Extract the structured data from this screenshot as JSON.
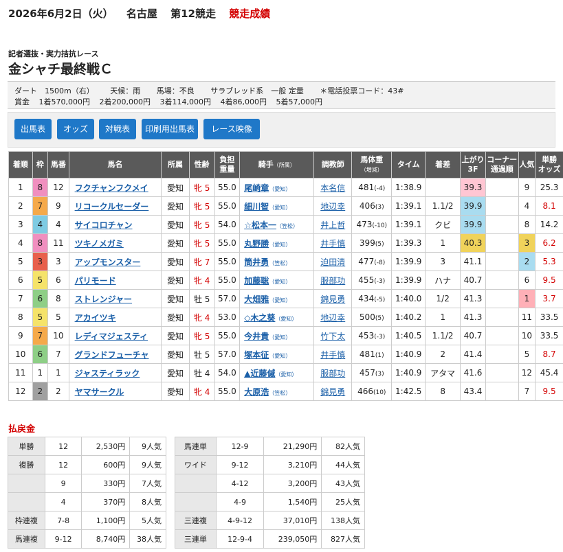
{
  "header": {
    "date": "2026年6月2日（火）",
    "venue": "名古屋",
    "race_no": "第12競走",
    "status": "競走成績"
  },
  "race": {
    "subtitle": "記者選抜・実力拮抗レース",
    "title": "金シャチ最終戦Ｃ"
  },
  "info": {
    "course": "ダート　1500m（右）",
    "weather": "天候：雨",
    "track": "馬場：不良",
    "breed": "サラブレッド系　一般 定量",
    "code": "＊電話投票コード：43#",
    "prize_label": "賞金",
    "prizes": [
      "1着570,000円",
      "2着200,000円",
      "3着114,000円",
      "4着86,000円",
      "5着57,000円"
    ]
  },
  "buttons": [
    "出馬表",
    "オッズ",
    "対戦表",
    "印刷用出馬表",
    "レース映像"
  ],
  "table": {
    "headers": {
      "order": "着順",
      "waku": "枠",
      "umaban": "馬番",
      "name": "馬名",
      "belong": "所属",
      "sexage": "性齢",
      "weight1": "負担",
      "weight2": "重量",
      "jockey": "騎手",
      "jockey_small": "（所属）",
      "trainer": "調教師",
      "body1": "馬体重",
      "body2": "（増減）",
      "time": "タイム",
      "margin": "着差",
      "up1": "上がり",
      "up2": "3F",
      "corner1": "コーナー",
      "corner2": "通過順",
      "pop": "人気",
      "odds1": "単勝",
      "odds2": "オッズ"
    },
    "rows": [
      {
        "order": "1",
        "waku": "8",
        "umaban": "12",
        "name": "フクチャンフクメイ",
        "belong": "愛知",
        "sex": "牝",
        "age": "5",
        "wt": "55.0",
        "jockey": "尾崎章",
        "jaff": "（愛知）",
        "trainer": "本名信",
        "bw": "481",
        "bwd": "(-4)",
        "time": "1:38.9",
        "margin": "",
        "up": "39.3",
        "pop": "9",
        "odds": "25.3"
      },
      {
        "order": "2",
        "waku": "7",
        "umaban": "9",
        "name": "リコークルセーダー",
        "belong": "愛知",
        "sex": "牝",
        "age": "5",
        "wt": "55.0",
        "jockey": "細川智",
        "jaff": "（愛知）",
        "trainer": "地辺幸",
        "bw": "406",
        "bwd": "(3)",
        "time": "1:39.1",
        "margin": "1.1/2",
        "up": "39.9",
        "pop": "4",
        "odds": "8.1"
      },
      {
        "order": "3",
        "waku": "4",
        "umaban": "4",
        "name": "サイコロチャン",
        "belong": "愛知",
        "sex": "牝",
        "age": "5",
        "wt": "54.0",
        "jockey": "☆松本一",
        "jaff": "（笠松）",
        "trainer": "井上哲",
        "bw": "473",
        "bwd": "(-10)",
        "time": "1:39.1",
        "margin": "クビ",
        "up": "39.9",
        "pop": "8",
        "odds": "14.2"
      },
      {
        "order": "4",
        "waku": "8",
        "umaban": "11",
        "name": "ツキノメガミ",
        "belong": "愛知",
        "sex": "牝",
        "age": "5",
        "wt": "55.0",
        "jockey": "丸野勝",
        "jaff": "（愛知）",
        "trainer": "井手慎",
        "bw": "399",
        "bwd": "(5)",
        "time": "1:39.3",
        "margin": "1",
        "up": "40.3",
        "pop": "3",
        "odds": "6.2"
      },
      {
        "order": "5",
        "waku": "3",
        "umaban": "3",
        "name": "アップモンスター",
        "belong": "愛知",
        "sex": "牝",
        "age": "7",
        "wt": "55.0",
        "jockey": "筒井勇",
        "jaff": "（笠松）",
        "trainer": "迫田清",
        "bw": "477",
        "bwd": "(-8)",
        "time": "1:39.9",
        "margin": "3",
        "up": "41.1",
        "pop": "2",
        "odds": "5.3"
      },
      {
        "order": "6",
        "waku": "5",
        "umaban": "6",
        "name": "パリモード",
        "belong": "愛知",
        "sex": "牝",
        "age": "4",
        "wt": "55.0",
        "jockey": "加藤聡",
        "jaff": "（愛知）",
        "trainer": "服部功",
        "bw": "455",
        "bwd": "(-3)",
        "time": "1:39.9",
        "margin": "ハナ",
        "up": "40.7",
        "pop": "6",
        "odds": "9.5"
      },
      {
        "order": "7",
        "waku": "6",
        "umaban": "8",
        "name": "ストレンジャー",
        "belong": "愛知",
        "sex": "牡",
        "age": "5",
        "wt": "57.0",
        "jockey": "大畑雅",
        "jaff": "（愛知）",
        "trainer": "錦見勇",
        "bw": "434",
        "bwd": "(-5)",
        "time": "1:40.0",
        "margin": "1/2",
        "up": "41.3",
        "pop": "1",
        "odds": "3.7"
      },
      {
        "order": "8",
        "waku": "5",
        "umaban": "5",
        "name": "アカイツキ",
        "belong": "愛知",
        "sex": "牝",
        "age": "4",
        "wt": "53.0",
        "jockey": "◇木之葵",
        "jaff": "（愛知）",
        "trainer": "地辺幸",
        "bw": "500",
        "bwd": "(5)",
        "time": "1:40.2",
        "margin": "1",
        "up": "41.3",
        "pop": "11",
        "odds": "33.5"
      },
      {
        "order": "9",
        "waku": "7",
        "umaban": "10",
        "name": "レディマジェスティ",
        "belong": "愛知",
        "sex": "牝",
        "age": "5",
        "wt": "55.0",
        "jockey": "今井貴",
        "jaff": "（愛知）",
        "trainer": "竹下太",
        "bw": "453",
        "bwd": "(-3)",
        "time": "1:40.5",
        "margin": "1.1/2",
        "up": "40.7",
        "pop": "10",
        "odds": "33.5"
      },
      {
        "order": "10",
        "waku": "6",
        "umaban": "7",
        "name": "グランドフューチャ",
        "belong": "愛知",
        "sex": "牡",
        "age": "5",
        "wt": "57.0",
        "jockey": "塚本征",
        "jaff": "（愛知）",
        "trainer": "井手慎",
        "bw": "481",
        "bwd": "(1)",
        "time": "1:40.9",
        "margin": "2",
        "up": "41.4",
        "pop": "5",
        "odds": "8.7"
      },
      {
        "order": "11",
        "waku": "1",
        "umaban": "1",
        "name": "ジャスティラック",
        "belong": "愛知",
        "sex": "牡",
        "age": "4",
        "wt": "54.0",
        "jockey": "▲近藤傶",
        "jaff": "（愛知）",
        "trainer": "服部功",
        "bw": "457",
        "bwd": "(3)",
        "time": "1:40.9",
        "margin": "アタマ",
        "up": "41.6",
        "pop": "12",
        "odds": "45.4"
      },
      {
        "order": "12",
        "waku": "2",
        "umaban": "2",
        "name": "ヤマサークル",
        "belong": "愛知",
        "sex": "牝",
        "age": "4",
        "wt": "55.0",
        "jockey": "大原浩",
        "jaff": "（笠松）",
        "trainer": "錦見勇",
        "bw": "466",
        "bwd": "(10)",
        "time": "1:42.5",
        "margin": "8",
        "up": "43.4",
        "pop": "7",
        "odds": "9.5"
      }
    ]
  },
  "payout": {
    "title": "払戻金",
    "left": [
      {
        "type": "単勝",
        "combo": "12",
        "amount": "2,530円",
        "pop": "9人気"
      },
      {
        "type": "複勝",
        "combo": "12",
        "amount": "600円",
        "pop": "9人気"
      },
      {
        "type": "",
        "combo": "9",
        "amount": "330円",
        "pop": "7人気"
      },
      {
        "type": "",
        "combo": "4",
        "amount": "370円",
        "pop": "8人気"
      },
      {
        "type": "枠連複",
        "combo": "7-8",
        "amount": "1,100円",
        "pop": "5人気"
      },
      {
        "type": "馬連複",
        "combo": "9-12",
        "amount": "8,740円",
        "pop": "38人気"
      }
    ],
    "right": [
      {
        "type": "馬連単",
        "combo": "12-9",
        "amount": "21,290円",
        "pop": "82人気"
      },
      {
        "type": "ワイド",
        "combo": "9-12",
        "amount": "3,210円",
        "pop": "44人気"
      },
      {
        "type": "",
        "combo": "4-12",
        "amount": "3,200円",
        "pop": "43人気"
      },
      {
        "type": "",
        "combo": "4-9",
        "amount": "1,540円",
        "pop": "25人気"
      },
      {
        "type": "三連複",
        "combo": "4-9-12",
        "amount": "37,010円",
        "pop": "138人気"
      },
      {
        "type": "三連単",
        "combo": "12-9-4",
        "amount": "239,050円",
        "pop": "827人気"
      }
    ]
  },
  "colors": {
    "waku": {
      "1": "#ffffff",
      "2": "#a0a0a0",
      "3": "#e8604c",
      "4": "#7ecbe3",
      "5": "#f5e36a",
      "6": "#8ecf86",
      "7": "#f5a94a",
      "8": "#f08fbf"
    },
    "button": "#1f78c8",
    "header_bg": "#5a5a5a",
    "red": "#d30000"
  }
}
